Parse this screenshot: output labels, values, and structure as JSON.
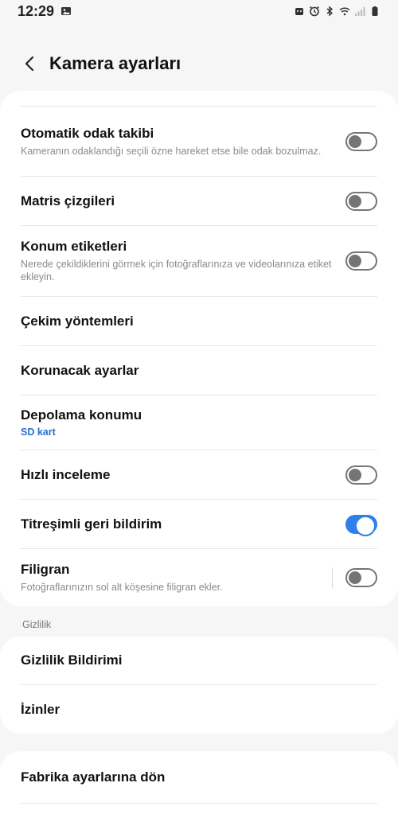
{
  "status_bar": {
    "time": "12:29",
    "icons_left": [
      "image-icon"
    ],
    "icons_right": [
      "android-icon",
      "alarm-icon",
      "bluetooth-icon",
      "wifi-icon",
      "signal-icon",
      "battery-icon"
    ]
  },
  "header": {
    "title": "Kamera ayarları",
    "back_icon": "chevron-left-icon"
  },
  "settings": [
    {
      "title": "Otomatik odak takibi",
      "desc": "Kameranın odaklandığı seçili özne hareket etse bile odak bozulmaz.",
      "toggle": false
    },
    {
      "title": "Matris çizgileri",
      "toggle": false
    },
    {
      "title": "Konum etiketleri",
      "desc": "Nerede çekildiklerini görmek için fotoğraflarınıza ve videolarınıza etiket ekleyin.",
      "toggle": false
    },
    {
      "title": "Çekim yöntemleri"
    },
    {
      "title": "Korunacak ayarlar"
    },
    {
      "title": "Depolama konumu",
      "sub": "SD kart"
    },
    {
      "title": "Hızlı inceleme",
      "toggle": false
    },
    {
      "title": "Titreşimli geri bildirim",
      "toggle": true
    },
    {
      "title": "Filigran",
      "desc": "Fotoğraflarınızın sol alt köşesine filigran ekler.",
      "toggle": false
    }
  ],
  "privacy_section": {
    "label": "Gizlilik",
    "items": [
      {
        "title": "Gizlilik Bildirimi"
      },
      {
        "title": "İzinler"
      }
    ]
  },
  "reset": {
    "title": "Fabrika ayarlarına dön"
  },
  "colors": {
    "accent": "#2f80ed",
    "link": "#2a6fd4",
    "background": "#f6f6f6"
  }
}
